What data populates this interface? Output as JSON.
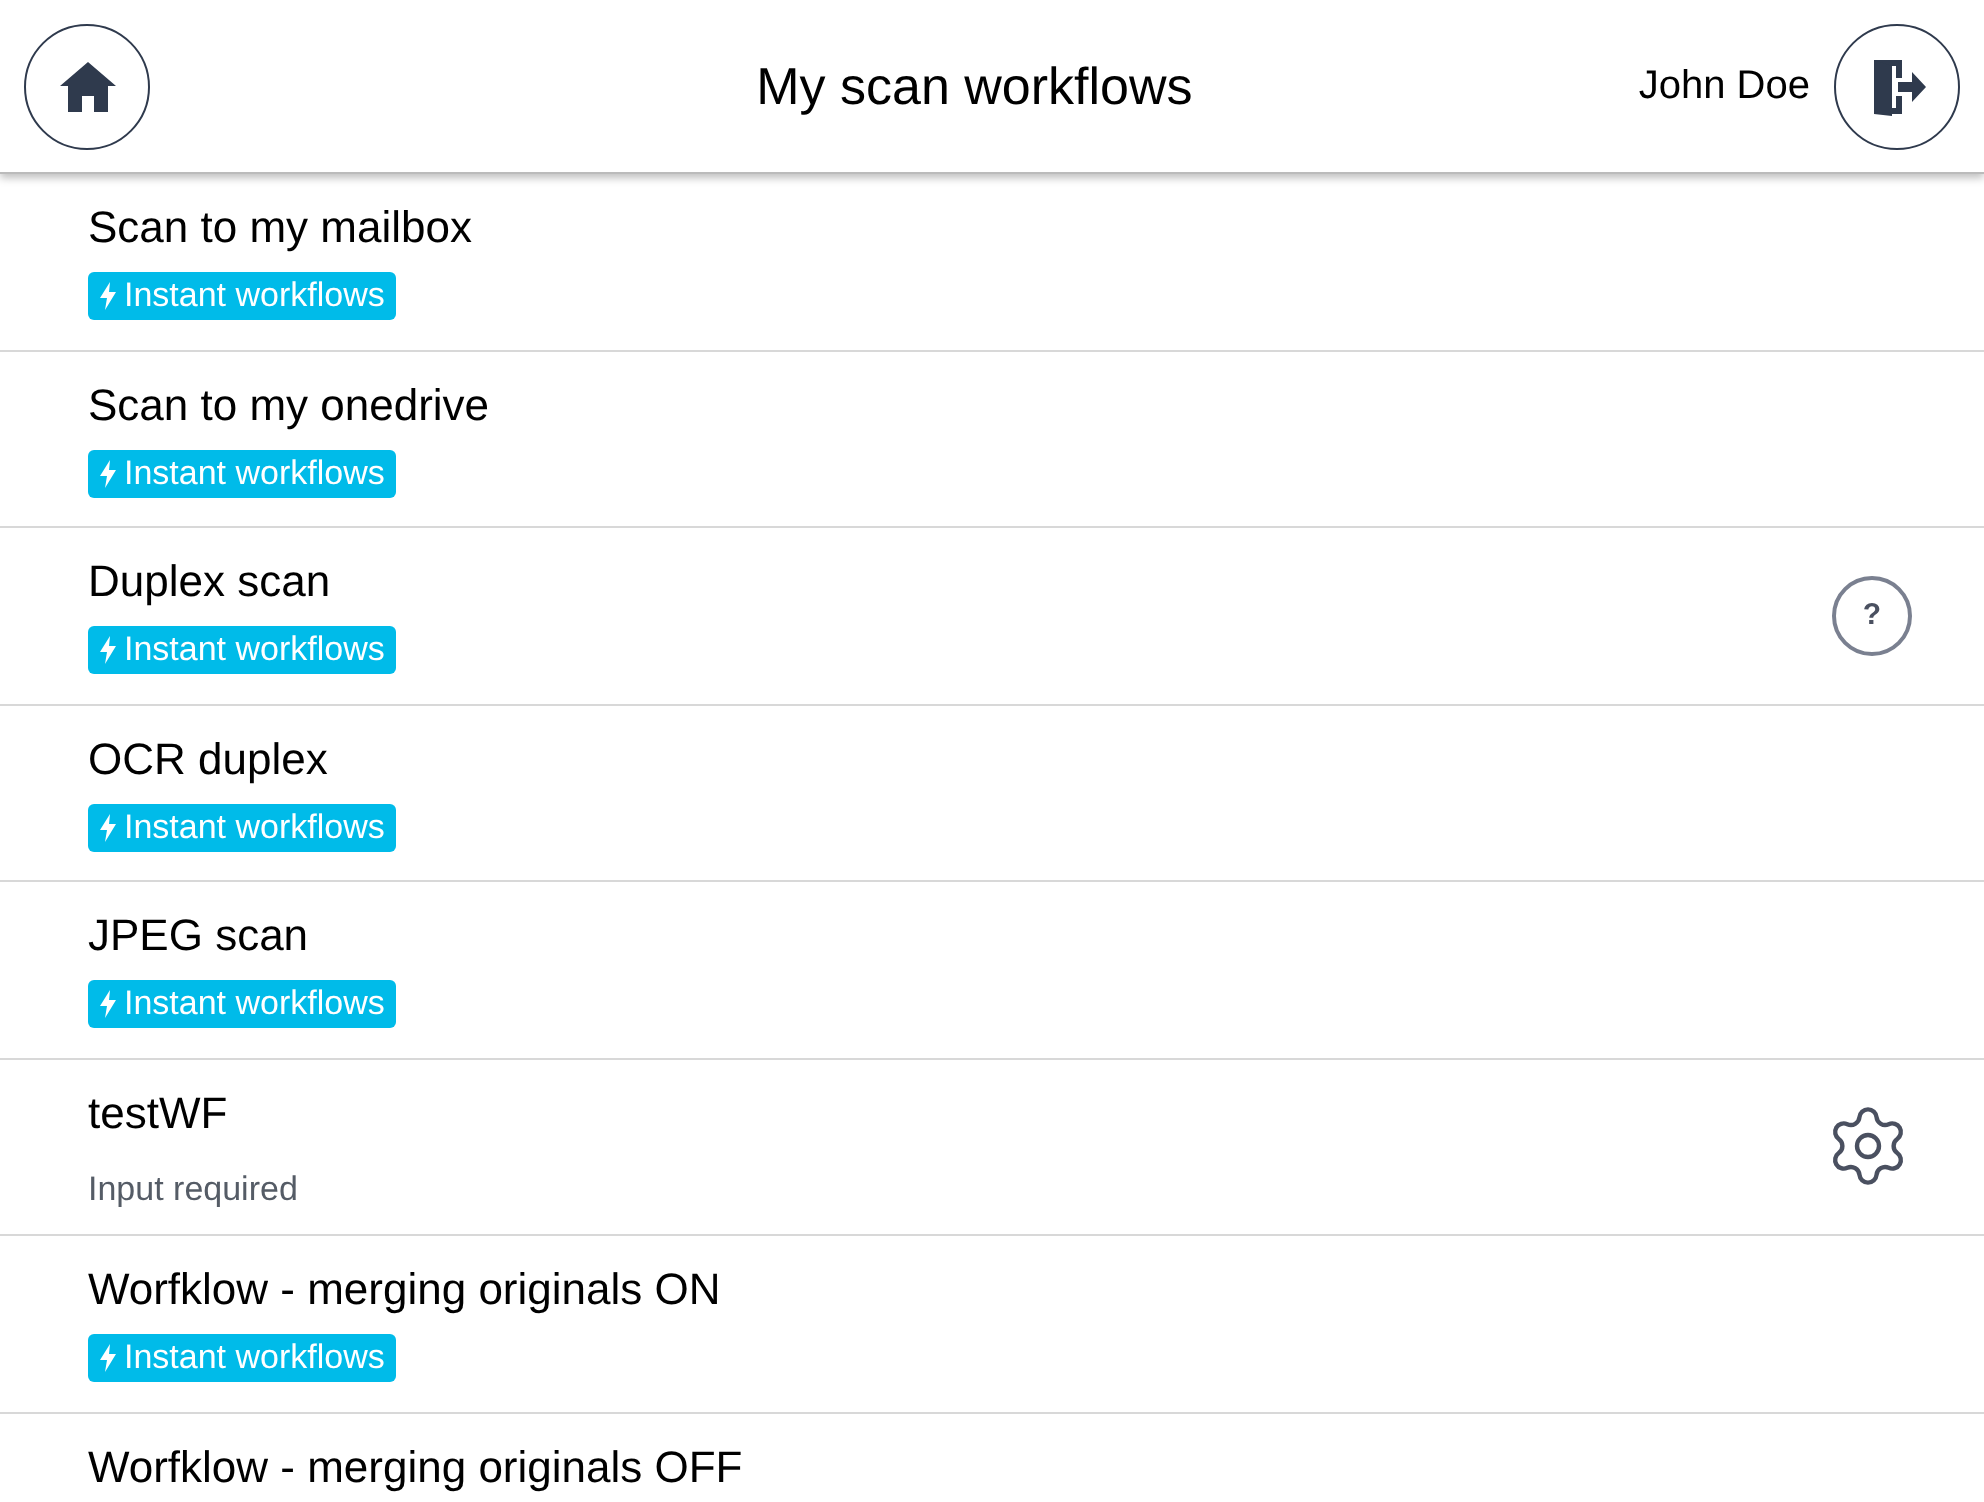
{
  "header": {
    "title": "My scan workflows",
    "user": "John Doe"
  },
  "workflows": [
    {
      "name": "Scan to my mailbox",
      "tag": {
        "kind": "badge",
        "text": "Instant workflows"
      }
    },
    {
      "name": "Scan to my onedrive",
      "tag": {
        "kind": "badge",
        "text": "Instant workflows"
      }
    },
    {
      "name": "Duplex scan",
      "tag": {
        "kind": "badge",
        "text": "Instant workflows"
      },
      "action": {
        "kind": "help",
        "label": "?"
      }
    },
    {
      "name": "OCR duplex",
      "tag": {
        "kind": "badge",
        "text": "Instant workflows"
      }
    },
    {
      "name": "JPEG scan",
      "tag": {
        "kind": "badge",
        "text": "Instant workflows"
      }
    },
    {
      "name": "testWF",
      "tag": {
        "kind": "note",
        "text": "Input required"
      },
      "action": {
        "kind": "settings"
      }
    },
    {
      "name": "Worfklow - merging originals ON",
      "tag": {
        "kind": "badge",
        "text": "Instant workflows"
      }
    },
    {
      "name": "Worfklow - merging originals OFF"
    }
  ]
}
